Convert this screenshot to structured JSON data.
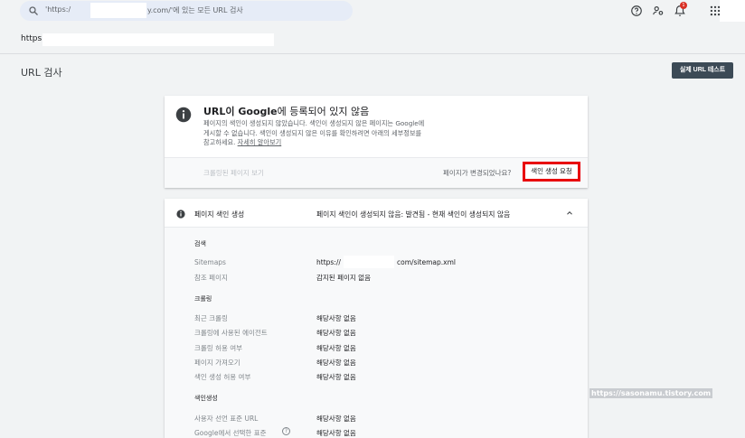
{
  "topbar": {
    "search_placeholder_prefix": "'https:/",
    "search_placeholder_suffix": "y.com/'에 있는 모든 URL 검사",
    "icons": [
      "help-icon",
      "account-settings-icon",
      "notifications-icon",
      "apps-grid-icon"
    ],
    "notification_count": "1"
  },
  "url_row": {
    "url_prefix": "https:/"
  },
  "page": {
    "title": "URL 검사",
    "live_test_label": "실제 URL 테스트"
  },
  "status_card": {
    "title_prefix": "URL이 ",
    "title_google": "Google",
    "title_suffix": "에 등록되어 있지 않음",
    "desc_line1": "페이지의 색인이 생성되지 않았습니다. 색인이 생성되지 않은 페이지는 Google에",
    "desc_line2": "게시할 수 없습니다. 색인이 생성되지 않은 이유를 확인하려면 아래의 세부정보를",
    "desc_line3_prefix": "참고하세요. ",
    "desc_link": "자세히 알아보기",
    "crawled_page_label": "크롤링된 페이지 보기",
    "page_changed_label": "페이지가 변경되었나요?",
    "request_index_label": "색인 생성 요청"
  },
  "index_card": {
    "header_label": "페이지 색인 생성",
    "header_status": "페이지 색인이 생성되지 않음: 발견됨 - 현재 색인이 생성되지 않음",
    "discovery": {
      "section": "검색",
      "sitemaps_label": "Sitemaps",
      "sitemaps_value_prefix": "https://",
      "sitemaps_value_suffix": "com/sitemap.xml",
      "referring_label": "참조 페이지",
      "referring_value": "감지된 페이지 없음"
    },
    "crawl": {
      "section": "크롤링",
      "rows": [
        {
          "label": "최근 크롤링",
          "value": "해당사항 없음"
        },
        {
          "label": "크롤링에 사용된 에이전트",
          "value": "해당사항 없음"
        },
        {
          "label": "크롤링 허용 여부",
          "value": "해당사항 없음"
        },
        {
          "label": "페이지 가져오기",
          "value": "해당사항 없음"
        },
        {
          "label": "색인 생성 허용 여부",
          "value": "해당사항 없음"
        }
      ]
    },
    "indexing": {
      "section": "색인생성",
      "rows": [
        {
          "label": "사용자 선언 표준 URL",
          "value": "해당사항 없음"
        },
        {
          "label": "Google에서 선택한 표준",
          "value": "해당사항 없음"
        }
      ]
    }
  },
  "watermark": "https://sasonamu.tistory.com"
}
